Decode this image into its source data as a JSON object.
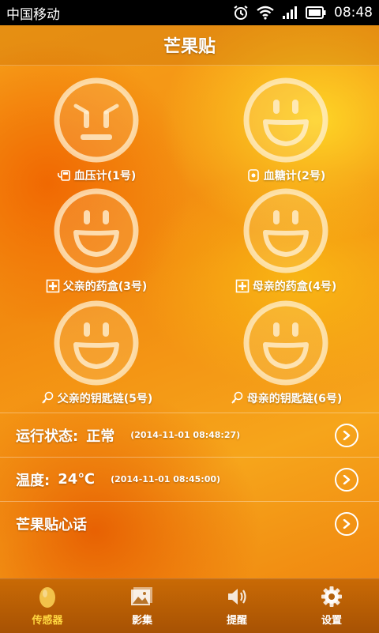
{
  "status_bar": {
    "carrier": "中国移动",
    "time": "08:48"
  },
  "app": {
    "title": "芒果贴"
  },
  "devices": [
    {
      "label": "血压计(1号)",
      "icon": "blood-pressure-meter-icon",
      "face": "worried"
    },
    {
      "label": "血糖计(2号)",
      "icon": "glucose-meter-icon",
      "face": "happy"
    },
    {
      "label": "父亲的药盒(3号)",
      "icon": "medicine-box-icon",
      "face": "happy"
    },
    {
      "label": "母亲的药盒(4号)",
      "icon": "medicine-box-icon",
      "face": "happy"
    },
    {
      "label": "父亲的钥匙链(5号)",
      "icon": "keychain-icon",
      "face": "happy"
    },
    {
      "label": "母亲的钥匙链(6号)",
      "icon": "keychain-icon",
      "face": "happy"
    }
  ],
  "status_rows": {
    "running": {
      "title": "运行状态:",
      "value": "正常",
      "time": "(2014-11-01 08:48:27)"
    },
    "temperature": {
      "title": "温度:",
      "value": "24℃",
      "time": "(2014-11-01 08:45:00)"
    },
    "heart_talk": {
      "title": "芒果贴心话"
    }
  },
  "tabs": [
    {
      "label": "传感器",
      "icon": "sensor-mango-icon",
      "active": true
    },
    {
      "label": "影集",
      "icon": "photo-album-icon",
      "active": false
    },
    {
      "label": "提醒",
      "icon": "speaker-icon",
      "active": false
    },
    {
      "label": "设置",
      "icon": "gear-icon",
      "active": false
    }
  ],
  "colors": {
    "tab_active": "#ffd640",
    "tab_bar": "#b85d04",
    "background": "#f28a0f"
  }
}
